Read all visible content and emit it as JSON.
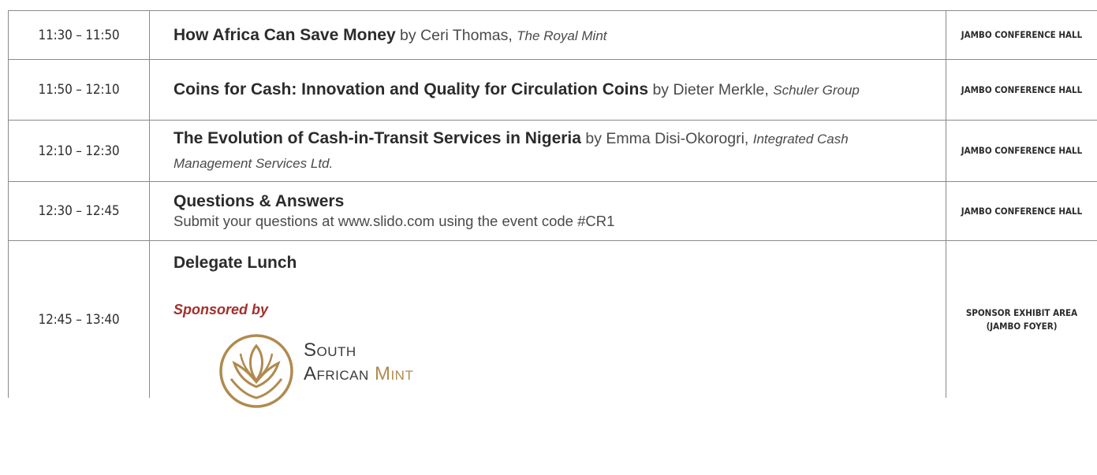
{
  "rows": [
    {
      "time": "11:30 – 11:50",
      "title": "How Africa Can Save Money",
      "by": " by Ceri Thomas, ",
      "org": "The Royal Mint",
      "venue": "JAMBO CONFERENCE HALL"
    },
    {
      "time": "11:50 – 12:10",
      "title": "Coins for Cash: Innovation and Quality for Circulation Coins",
      "by": " by Dieter Merkle, ",
      "org": "Schuler Group",
      "venue": "JAMBO CONFERENCE HALL"
    },
    {
      "time": "12:10 – 12:30",
      "title": "The Evolution of Cash-in-Transit Services in Nigeria",
      "by": " by Emma Disi-Okorogri, ",
      "org": "Integrated Cash Management Services Ltd.",
      "venue": "JAMBO CONFERENCE HALL"
    },
    {
      "time": "12:30 – 12:45",
      "title": "Questions & Answers",
      "subtitle": "Submit your questions at www.slido.com using the event code #CR1",
      "venue": "JAMBO CONFERENCE HALL"
    },
    {
      "time": "12:45 – 13:40",
      "title": "Delegate Lunch",
      "sponsored": "Sponsored by",
      "logo_line1": "South",
      "logo_line2a": "African ",
      "logo_line2b": "Mint",
      "venue": "SPONSOR EXHIBIT AREA (JAMBO FOYER)"
    }
  ],
  "colors": {
    "border": "#8a8a8a",
    "sponsor_red": "#a1302b",
    "mint_gold": "#b08a4e"
  }
}
